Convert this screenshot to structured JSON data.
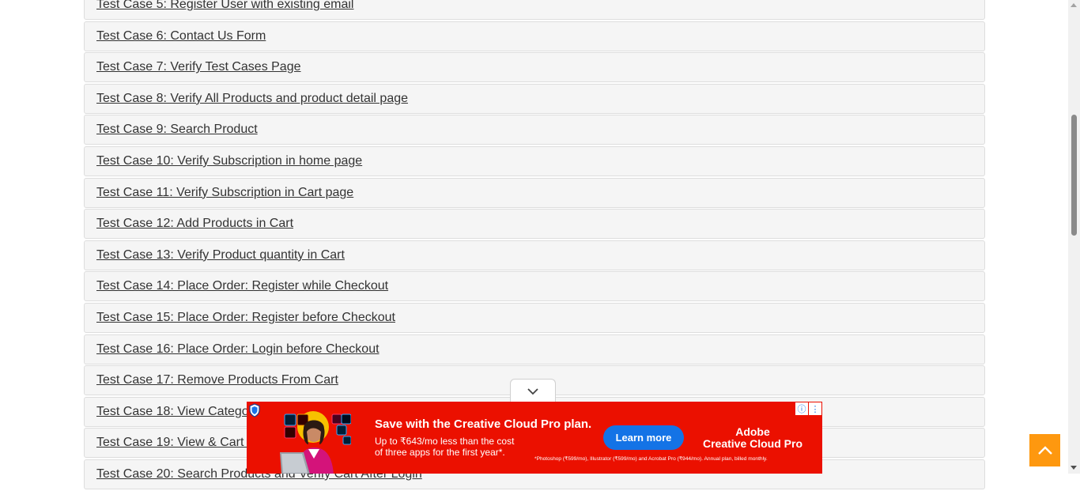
{
  "test_cases": [
    "Test Case 5: Register User with existing email",
    "Test Case 6: Contact Us Form",
    "Test Case 7: Verify Test Cases Page",
    "Test Case 8: Verify All Products and product detail page",
    "Test Case 9: Search Product",
    "Test Case 10: Verify Subscription in home page",
    "Test Case 11: Verify Subscription in Cart page",
    "Test Case 12: Add Products in Cart",
    "Test Case 13: Verify Product quantity in Cart",
    "Test Case 14: Place Order: Register while Checkout",
    "Test Case 15: Place Order: Register before Checkout",
    "Test Case 16: Place Order: Login before Checkout",
    "Test Case 17: Remove Products From Cart",
    "Test Case 18: View Category Products",
    "Test Case 19: View & Cart Brand Products",
    "Test Case 20: Search Products and Verify Cart After Login"
  ],
  "ad": {
    "headline": "Save with the Creative Cloud Pro plan.",
    "subtext_line1": "Up to ₹643/mo less than the cost",
    "subtext_line2": "of three apps for the first year*.",
    "cta": "Learn more",
    "brand_line1": "Adobe",
    "brand_line2": "Creative Cloud Pro",
    "fine_print": "*Photoshop (₹599/mo), Illustrator (₹599/mo) and Acrobat Pro (₹944/mo). Annual plan, billed monthly.",
    "info_icon": "ⓘ",
    "menu_icon": "⋮"
  },
  "colors": {
    "row_bg": "#f5f5f5",
    "link": "#333333",
    "ad_bg": "#eb1000",
    "ad_cta": "#1473e6",
    "scroll_top": "#fe980f"
  },
  "icons": {
    "scroll_top": "chevron-up-icon",
    "ad_collapse": "chevron-down-icon",
    "ad_shield": "shield-icon"
  }
}
